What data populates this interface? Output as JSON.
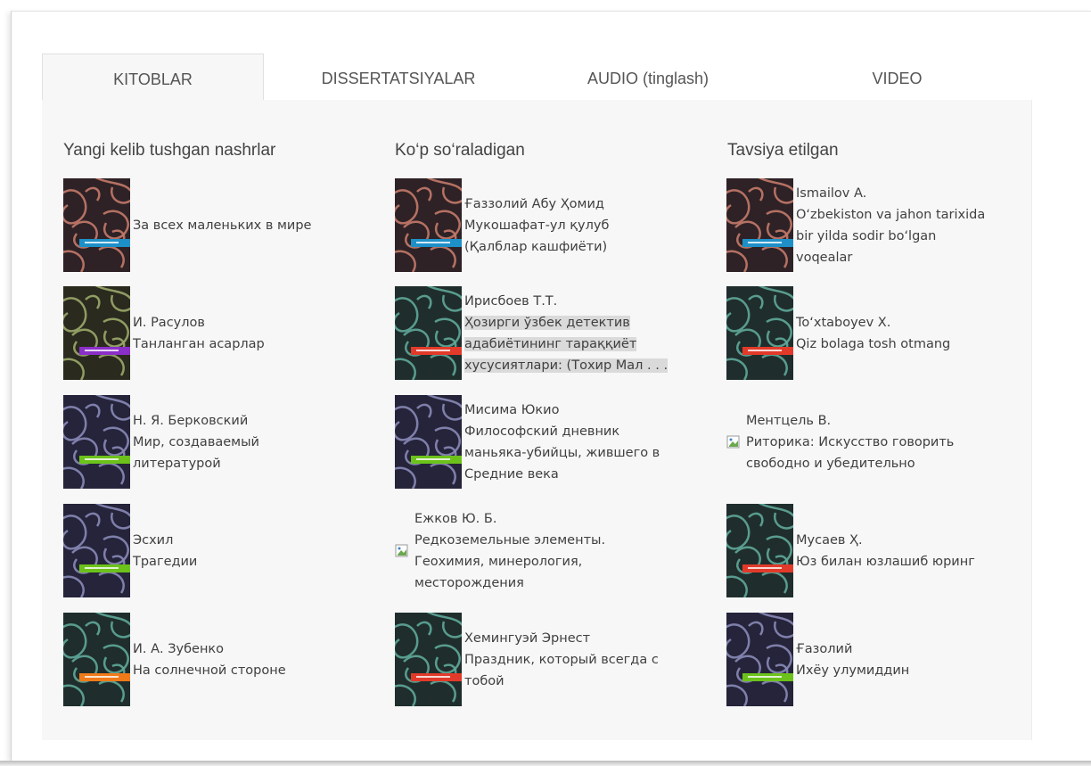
{
  "tabs": [
    {
      "label": "KITOBLAR",
      "active": true
    },
    {
      "label": "DISSERTATSIYALAR",
      "active": false
    },
    {
      "label": "AUDIO (tinglash)",
      "active": false
    },
    {
      "label": "VIDEO",
      "active": false
    }
  ],
  "columns": [
    {
      "title": "Yangi kelib tushgan nashrlar",
      "items": [
        {
          "lines": [
            "За всех маленьких в мире"
          ],
          "cover": {
            "bg": "#2e2226",
            "pattern": "#c47a6a",
            "band": "#1e90c8"
          }
        },
        {
          "lines": [
            "И. Расулов",
            "Танланган асарлар"
          ],
          "cover": {
            "bg": "#2b2a1e",
            "pattern": "#9aa86a",
            "band": "#8b2fc9"
          }
        },
        {
          "lines": [
            "Н. Я. Берковский",
            "Мир, создаваемый",
            "литературой"
          ],
          "cover": {
            "bg": "#25243a",
            "pattern": "#8a8ab8",
            "band": "#6cc21a"
          }
        },
        {
          "lines": [
            "Эсхил",
            "Трагедии"
          ],
          "cover": {
            "bg": "#25243a",
            "pattern": "#8a8ab8",
            "band": "#6cc21a"
          }
        },
        {
          "lines": [
            "И. А. Зубенко",
            "На солнечной стороне"
          ],
          "cover": {
            "bg": "#1f2e2c",
            "pattern": "#5fa89a",
            "band": "#f07a1a"
          }
        }
      ]
    },
    {
      "title": "Ko‘p so‘raladigan",
      "items": [
        {
          "lines": [
            "Ғаззолий Абу Ҳомид",
            "Мукошафат-ул қулуб",
            "(Қалблар кашфиёти)"
          ],
          "cover": {
            "bg": "#2e2226",
            "pattern": "#c47a6a",
            "band": "#1e90c8"
          }
        },
        {
          "lines": [
            "Ирисбоев Т.Т.",
            "Ҳозирги ўзбек детектив",
            "адабиётининг тараққиёт",
            "хусусиятлари: (Тохир Мал . . ."
          ],
          "highlight_from": 1,
          "cover": {
            "bg": "#1f2e2c",
            "pattern": "#5fa89a",
            "band": "#e23a2a"
          }
        },
        {
          "lines": [
            "Мисима Юкио",
            "Философский дневник",
            "маньяка-убийцы, жившего в",
            "Средние века"
          ],
          "cover": {
            "bg": "#25243a",
            "pattern": "#8a8ab8",
            "band": "#6cc21a"
          }
        },
        {
          "lines": [
            "Ежков Ю. Б.",
            "Редкоземельные элементы.",
            "Геохимия, минерология,",
            "месторождения"
          ],
          "broken": true
        },
        {
          "lines": [
            "Хемингуэй Эрнест",
            "Праздник, который всегда с",
            "тобой"
          ],
          "cover": {
            "bg": "#1f2e2c",
            "pattern": "#5fa89a",
            "band": "#e23a2a"
          }
        }
      ]
    },
    {
      "title": "Tavsiya etilgan",
      "items": [
        {
          "lines": [
            "Ismailov A.",
            "O‘zbekiston va jahon tarixida",
            "bir yilda sodir bo‘lgan",
            "voqealar"
          ],
          "cover": {
            "bg": "#2e2226",
            "pattern": "#c47a6a",
            "band": "#1e90c8"
          }
        },
        {
          "lines": [
            "To‘xtaboyev X.",
            "Qiz bolaga tosh otmang"
          ],
          "cover": {
            "bg": "#1f2e2c",
            "pattern": "#5fa89a",
            "band": "#e23a2a"
          }
        },
        {
          "lines": [
            "Ментцель В.",
            "Риторика: Искусство говорить",
            "свободно и убедительно"
          ],
          "broken": true
        },
        {
          "lines": [
            "Мусаев Ҳ.",
            "Юз билан юзлашиб юринг"
          ],
          "cover": {
            "bg": "#1f2e2c",
            "pattern": "#5fa89a",
            "band": "#e23a2a"
          }
        },
        {
          "lines": [
            "Ғазолий",
            "Ихёу улумиддин"
          ],
          "cover": {
            "bg": "#25243a",
            "pattern": "#8a8ab8",
            "band": "#6cc21a"
          }
        }
      ]
    }
  ]
}
